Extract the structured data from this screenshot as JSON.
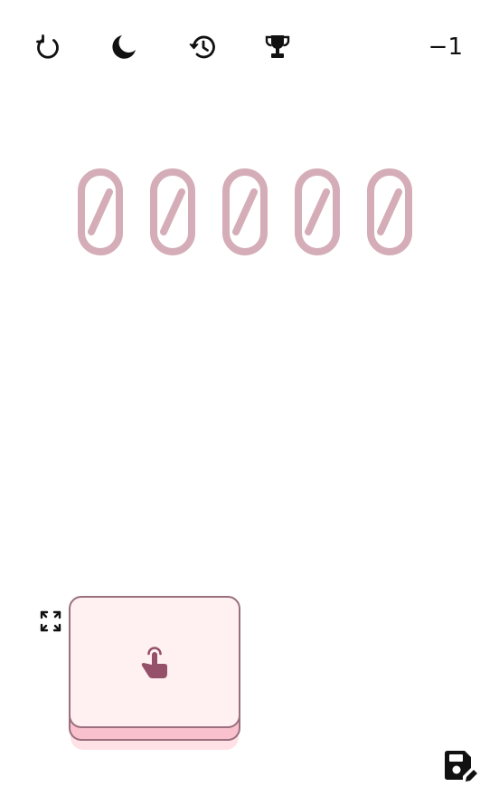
{
  "toolbar": {
    "icons": [
      "reset-icon",
      "moon-icon",
      "history-icon",
      "trophy-icon"
    ],
    "step_value": "−1"
  },
  "counter": {
    "digits": [
      "0",
      "0",
      "0",
      "0",
      "0"
    ],
    "digit_color": "#d4adb8"
  },
  "tap_key": {
    "icon": "tap-finger-icon",
    "face_color": "#fff0f1",
    "base_color": "#f9c0cd",
    "border_color": "#9a6f7e",
    "icon_color": "#95506a"
  },
  "footer": {
    "icons": [
      "fullscreen-icon",
      "save-edit-icon"
    ]
  }
}
